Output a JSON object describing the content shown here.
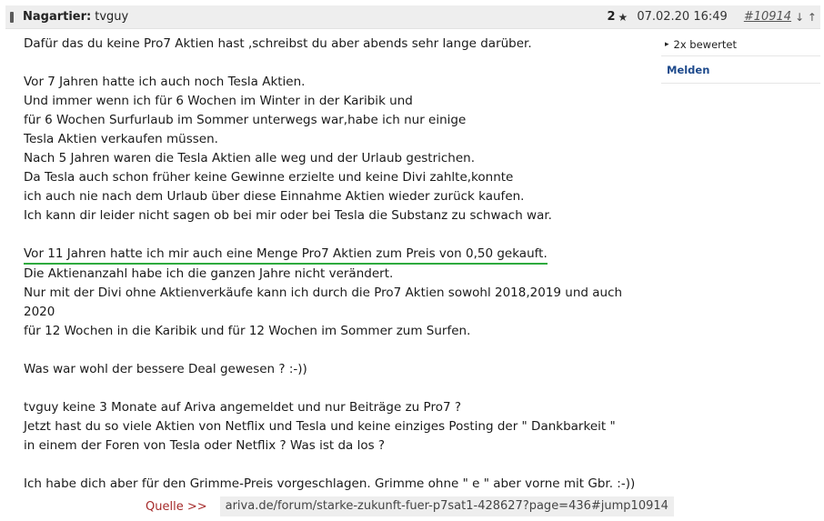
{
  "header": {
    "nick_label": "Nagartier:",
    "nick": "tvguy",
    "rating_count": "2",
    "star_symbol": "★",
    "date": "07.02.20 16:49",
    "post_number": "#10914",
    "arrows": "↓ ↑"
  },
  "body": [
    "Dafür das du keine Pro7 Aktien hast ,schreibst du aber abends sehr lange darüber.",
    "",
    "Vor 7 Jahren hatte ich auch noch Tesla Aktien.",
    "Und immer wenn ich für 6 Wochen im Winter in der Karibik und",
    "für 6 Wochen Surfurlaub im Sommer unterwegs war,habe ich nur einige",
    "Tesla Aktien verkaufen müssen.",
    "Nach 5 Jahren waren die Tesla Aktien alle weg und der Urlaub gestrichen.",
    "Da Tesla auch schon früher keine Gewinne erzielte und keine Divi zahlte,konnte",
    "ich auch nie nach dem Urlaub über diese Einnahme Aktien wieder zurück kaufen.",
    "Ich kann dir leider nicht sagen ob bei mir oder bei Tesla die Substanz zu schwach war.",
    "",
    "Vor 11 Jahren hatte ich mir auch eine Menge Pro7 Aktien zum Preis von 0,50  gekauft.",
    "Die Aktienanzahl habe ich die ganzen Jahre nicht verändert.",
    "Nur mit der Divi ohne Aktienverkäufe kann ich durch die Pro7 Aktien sowohl 2018,2019 und auch",
    "2020",
    "für 12 Wochen in die Karibik und für 12 Wochen im Sommer zum Surfen.",
    "",
    "Was war wohl der bessere Deal gewesen ? :-))",
    "",
    "tvguy keine 3 Monate auf Ariva angemeldet und nur Beiträge zu Pro7 ?",
    "Jetzt hast du so viele Aktien von Netflix und Tesla und keine einziges Posting der \" Dankbarkeit \"",
    "in einem der Foren von Tesla oder Netflix ? Was ist da los ?",
    "",
    "Ich habe dich aber für den Grimme-Preis vorgeschlagen. Grimme ohne \" e \" aber vorne mit Gbr. :-))"
  ],
  "highlight_line_index": 11,
  "side": {
    "rated_symbol": "▸",
    "rated": "2x bewertet",
    "report": "Melden"
  },
  "source": {
    "label": "Quelle >>",
    "url": "ariva.de/forum/starke-zukunft-fuer-p7sat1-428627?page=436#jump10914"
  },
  "colors": {
    "highlight_underline": "#2eaa3e",
    "source_label": "#a52a2a",
    "report_link": "#1e4a8c",
    "header_bg": "#eeeeee"
  },
  "icons": {
    "user": "user-bar-icon",
    "star": "star-icon",
    "arrows": "sort-arrows-icon",
    "rated": "triangle-right-icon"
  }
}
